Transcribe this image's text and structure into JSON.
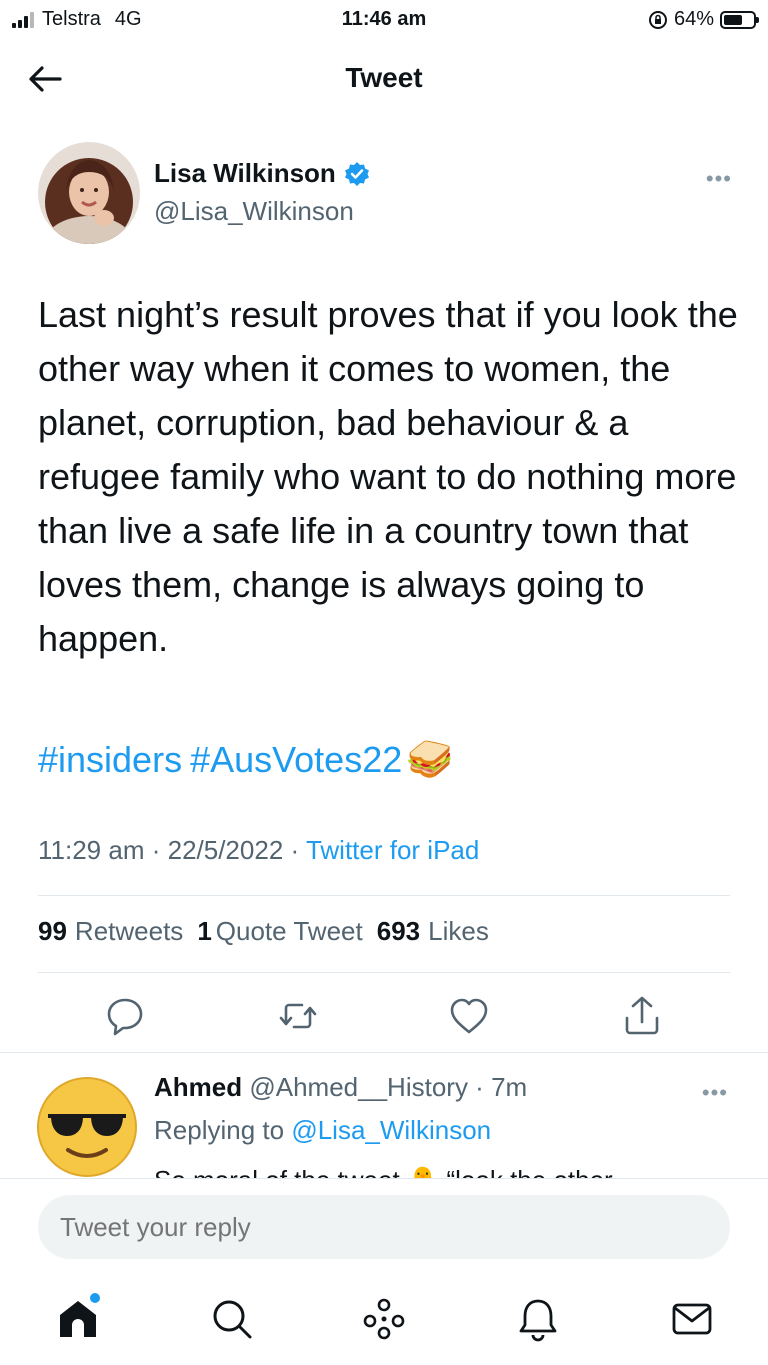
{
  "status_bar": {
    "carrier": "Telstra",
    "network": "4G",
    "time": "11:46 am",
    "battery": "64%",
    "battery_level": 0.64
  },
  "header": {
    "title": "Tweet",
    "back_icon": "arrow-left-icon"
  },
  "tweet": {
    "author_name": "Lisa Wilkinson",
    "author_handle": "@Lisa_Wilkinson",
    "verified": true,
    "text": "Last night’s result proves that if you look the other way when it comes to women, the planet, corruption, bad behaviour & a refugee family who want to do nothing more than live a safe life in a country town that loves them, change is always going to happen.",
    "hashtags": [
      "#insiders",
      "#AusVotes22"
    ],
    "emoji": "🥪",
    "time": "11:29 am",
    "date": "22/5/2022",
    "source": "Twitter for iPad",
    "retweets_count": "99",
    "retweets_label": "Retweets",
    "quotes_count": "1",
    "quotes_label": "Quote Tweet",
    "likes_count": "693",
    "likes_label": "Likes"
  },
  "reply": {
    "name": "Ahmed",
    "handle": "@Ahmed__History",
    "age": "7m",
    "replying_prefix": "Replying to",
    "replying_to": "@Lisa_Wilkinson",
    "snippet": "So moral of the tweet 🐥 “look the other",
    "avatar_emoji": "😎"
  },
  "composer": {
    "placeholder": "Tweet your reply"
  },
  "colors": {
    "accent": "#1d9bf0",
    "text": "#0f1419",
    "secondary": "#536471"
  }
}
